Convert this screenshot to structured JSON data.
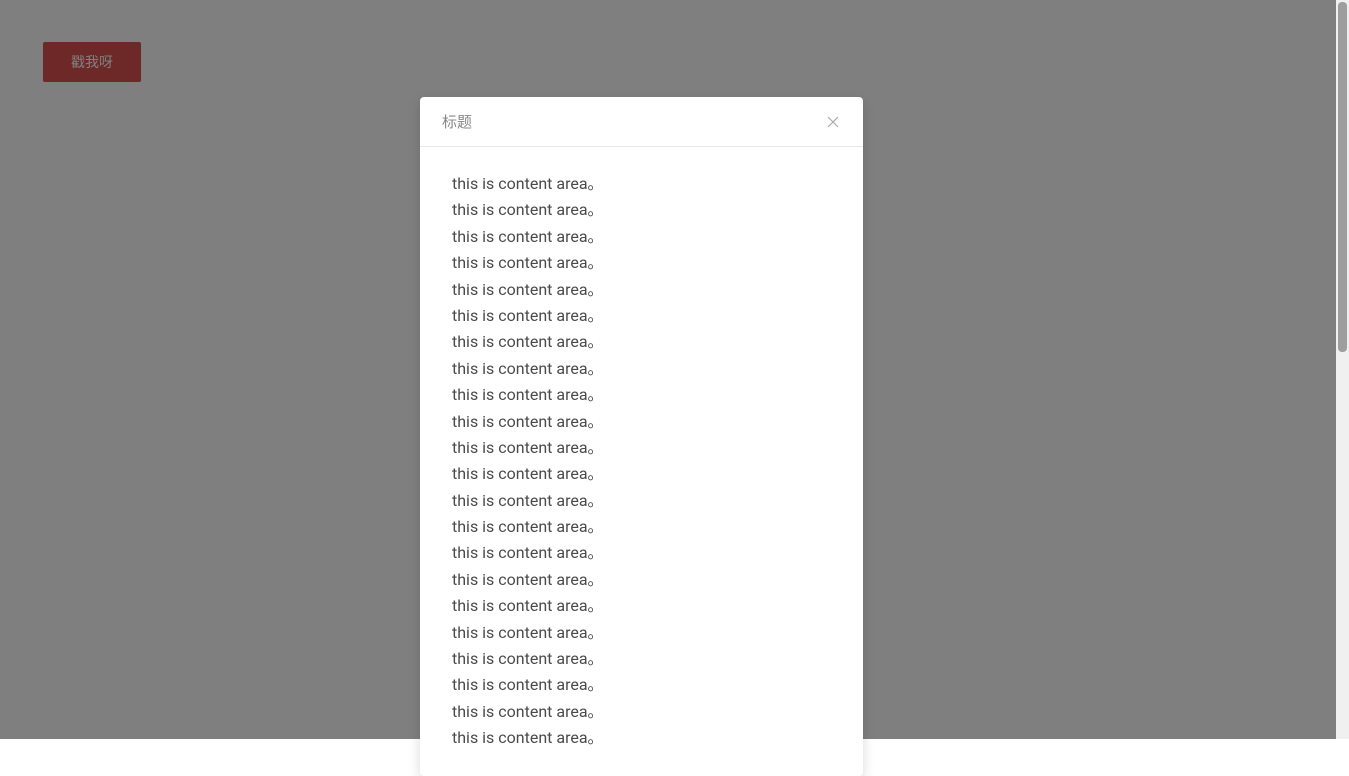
{
  "trigger_button": {
    "label": "戳我呀"
  },
  "modal": {
    "title": "标题",
    "content_lines": [
      "this is content area。",
      "this is content area。",
      "this is content area。",
      "this is content area。",
      "this is content area。",
      "this is content area。",
      "this is content area。",
      "this is content area。",
      "this is content area。",
      "this is content area。",
      "this is content area。",
      "this is content area。",
      "this is content area。",
      "this is content area。",
      "this is content area。",
      "this is content area。",
      "this is content area。",
      "this is content area。",
      "this is content area。",
      "this is content area。",
      "this is content area。",
      "this is content area。"
    ]
  }
}
